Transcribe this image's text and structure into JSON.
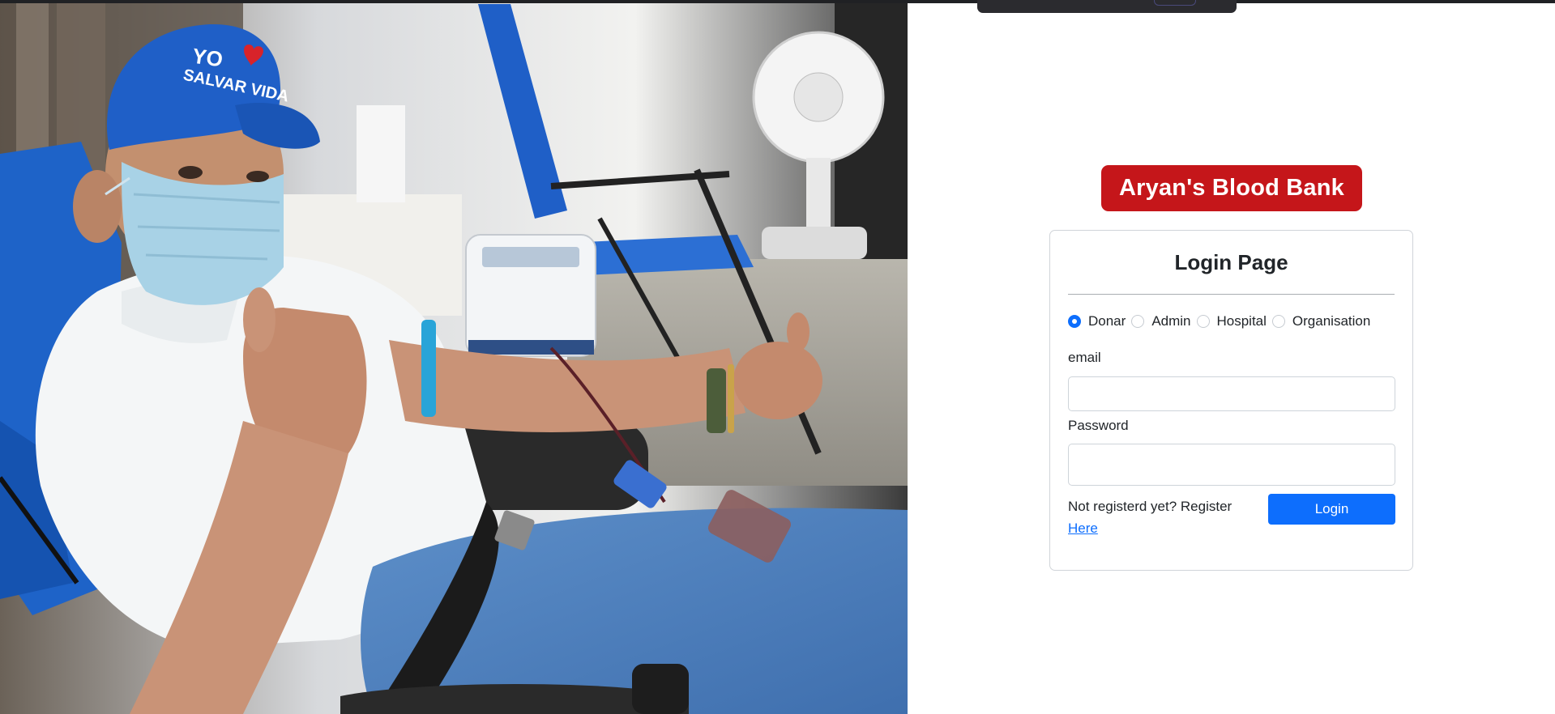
{
  "brand": {
    "title": "Aryan's Blood Bank",
    "color": "#c5161a"
  },
  "photo": {
    "description_icon": "blood-donor-photo",
    "cap_text_line1": "YO",
    "cap_text_line2": "SALVAR VIDA"
  },
  "login": {
    "heading": "Login Page",
    "roles": [
      {
        "label": "Donar",
        "checked": true
      },
      {
        "label": "Admin",
        "checked": false
      },
      {
        "label": "Hospital",
        "checked": false
      },
      {
        "label": "Organisation",
        "checked": false
      }
    ],
    "email_label": "email",
    "email_value": "",
    "password_label": "Password",
    "password_value": "",
    "register_prompt": "Not registerd yet? Register",
    "register_link": "Here",
    "login_button": "Login",
    "accent_color": "#0d6efd"
  }
}
